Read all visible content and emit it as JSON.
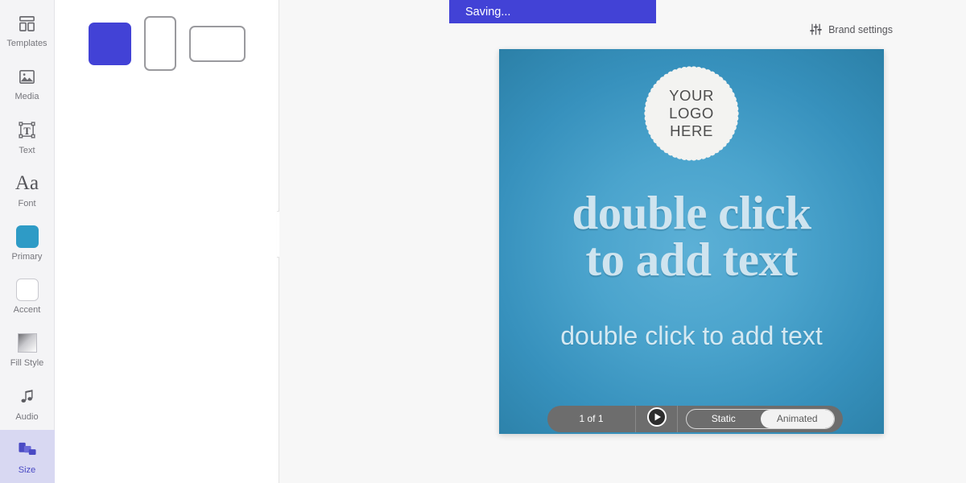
{
  "sidebar": {
    "items": [
      {
        "label": "Templates",
        "icon": "layout-grid-icon",
        "active": false
      },
      {
        "label": "Media",
        "icon": "image-icon",
        "active": false
      },
      {
        "label": "Text",
        "icon": "text-box-icon",
        "active": false
      },
      {
        "label": "Font",
        "icon": "font-aa-icon",
        "active": false
      },
      {
        "label": "Primary",
        "icon": "color-swatch-primary-icon",
        "active": false
      },
      {
        "label": "Accent",
        "icon": "color-swatch-accent-icon",
        "active": false
      },
      {
        "label": "Fill Style",
        "icon": "gradient-swatch-icon",
        "active": false
      },
      {
        "label": "Audio",
        "icon": "music-note-icon",
        "active": false
      },
      {
        "label": "Size",
        "icon": "resize-shapes-icon",
        "active": true
      }
    ],
    "active_color": "#4a4ac4",
    "active_bg": "#d8d8f2"
  },
  "size_panel": {
    "ratios": [
      {
        "name": "square",
        "selected": true
      },
      {
        "name": "portrait",
        "selected": false
      },
      {
        "name": "landscape",
        "selected": false
      }
    ],
    "selected_color": "#4242d6",
    "collapse_icon": "chevron-left-icon"
  },
  "header": {
    "saving_text": "Saving...",
    "saving_bg": "#4242d6",
    "brand_settings_label": "Brand settings",
    "brand_settings_icon": "sliders-icon"
  },
  "canvas": {
    "logo": {
      "line1": "YOUR",
      "line2": "LOGO",
      "line3": "HERE"
    },
    "headline_line1": "double click",
    "headline_line2": "to add text",
    "subhead": "double click to add text",
    "bg_center_color": "#5cb0d6",
    "bg_edge_color": "#2a7ea5",
    "headline_color": "#cfe4ef",
    "subhead_color": "#d5e9f2"
  },
  "bottom_bar": {
    "page_indicator": "1 of 1",
    "play_icon": "play-circle-icon",
    "modes": [
      {
        "label": "Static",
        "selected": false
      },
      {
        "label": "Animated",
        "selected": true
      }
    ]
  }
}
